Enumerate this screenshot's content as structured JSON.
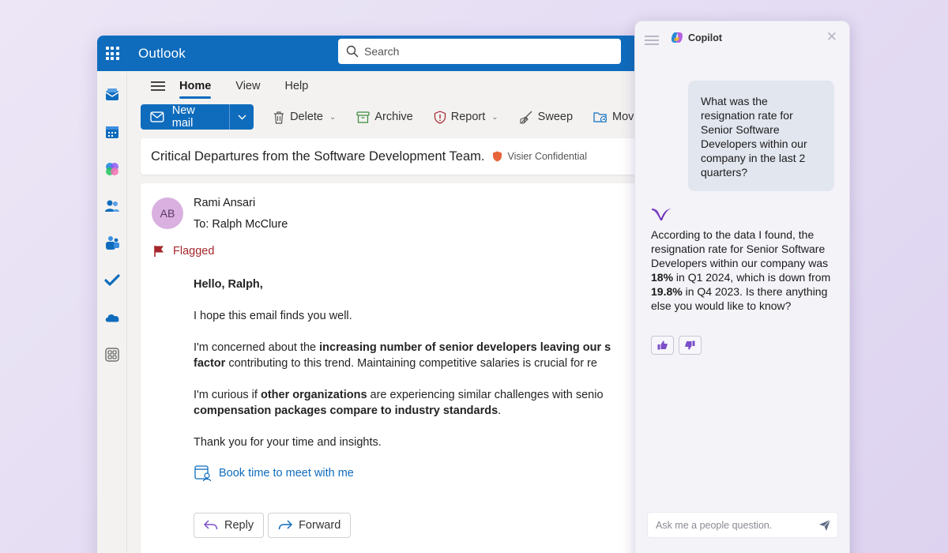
{
  "outlook": {
    "app_name": "Outlook",
    "search_placeholder": "Search",
    "tabs": [
      {
        "label": "Home",
        "active": true
      },
      {
        "label": "View",
        "active": false
      },
      {
        "label": "Help",
        "active": false
      }
    ],
    "ribbon": {
      "new_mail": "New mail",
      "delete": "Delete",
      "archive": "Archive",
      "report": "Report",
      "sweep": "Sweep",
      "move_to": "Move to"
    },
    "rail_icons": [
      "mail-icon",
      "calendar-icon",
      "copilot-icon",
      "people-icon",
      "teams-icon",
      "todo-icon",
      "onedrive-icon",
      "apps-icon"
    ],
    "email": {
      "subject": "Critical Departures from the Software Development Team.",
      "sensitivity": "Visier Confidential",
      "avatar_initials": "AB",
      "sender": "Rami Ansari",
      "to_line": "To: Ralph McClure",
      "flag_status": "Flagged",
      "greeting": "Hello, Ralph,",
      "para1": "I hope this email finds you well.",
      "para2_pre": "I'm concerned about the ",
      "para2_bold1": "increasing number of senior developers leaving our s",
      "para2_bold2": "factor",
      "para2_post": " contributing to this trend. Maintaining competitive salaries is crucial for re",
      "para3_pre": "I'm curious if ",
      "para3_bold1": "other organizations",
      "para3_mid": " are experiencing similar challenges with senio",
      "para3_bold2": "compensation packages compare to industry standards",
      "para3_post": ".",
      "para4": "Thank you for your time and insights.",
      "book_link": "Book time to meet with me",
      "reply": "Reply",
      "forward": "Forward"
    },
    "colors": {
      "brand": "#0f6cbd",
      "flag": "#a4262c",
      "avatar_bg": "#d9b0e0"
    }
  },
  "copilot": {
    "title": "Copilot",
    "user_question": "What was the resignation rate for Senior Software Developers within our company in the last 2 quarters?",
    "answer_pre": "According to the data I found, the resignation rate for Senior Software Developers within our company was ",
    "answer_bold1": "18%",
    "answer_mid": " in Q1 2024, which is down from ",
    "answer_bold2": "19.8%",
    "answer_post": " in Q4 2023. Is there anything else you would like to know?",
    "input_placeholder": "Ask me a people question.",
    "colors": {
      "accent": "#6b3fc4",
      "bubble": "#e2e6ef"
    }
  }
}
